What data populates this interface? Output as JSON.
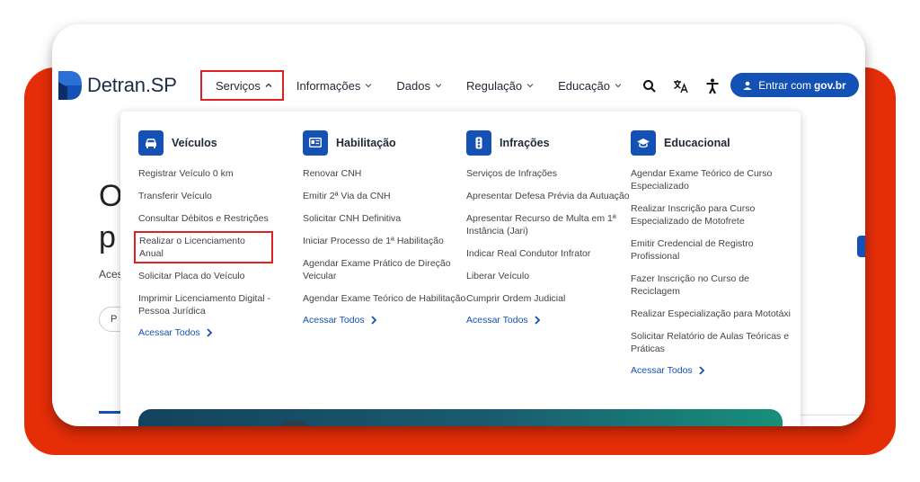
{
  "header": {
    "logo_text": "Detran.SP",
    "nav": [
      {
        "label": "Serviços"
      },
      {
        "label": "Informações"
      },
      {
        "label": "Dados"
      },
      {
        "label": "Regulação"
      },
      {
        "label": "Educação"
      }
    ],
    "login": {
      "label": "Entrar com",
      "bold": "gov.br"
    },
    "icons": [
      "search-icon",
      "translate-icon",
      "accessibility-icon"
    ]
  },
  "background": {
    "title_line1": "O",
    "title_line2": "p",
    "text": "Aces",
    "pill": "P"
  },
  "menu": {
    "columns": [
      {
        "title": "Veículos",
        "icon": "car-icon",
        "links": [
          "Registrar Veículo 0 km",
          "Transferir Veículo",
          "Consultar Débitos e Restrições",
          "Realizar o Licenciamento Anual",
          "Solicitar Placa do Veículo",
          "Imprimir Licenciamento Digital - Pessoa Jurídica"
        ],
        "all": "Acessar Todos"
      },
      {
        "title": "Habilitação",
        "icon": "id-card-icon",
        "links": [
          "Renovar CNH",
          "Emitir 2ª Via da CNH",
          "Solicitar CNH Definitiva",
          "Iniciar Processo de 1ª Habilitação",
          "Agendar Exame Prático de Direção Veicular",
          "Agendar Exame Teórico de Habilitação"
        ],
        "all": "Acessar Todos"
      },
      {
        "title": "Infrações",
        "icon": "traffic-light-icon",
        "links": [
          "Serviços de Infrações",
          "Apresentar Defesa Prévia da Autuação",
          "Apresentar Recurso de Multa em 1ª Instância (Jari)",
          "Indicar Real Condutor Infrator",
          "Liberar Veículo",
          "Cumprir Ordem Judicial"
        ],
        "all": "Acessar Todos"
      },
      {
        "title": "Educacional",
        "icon": "graduation-cap-icon",
        "links": [
          "Agendar Exame Teórico de Curso Especializado",
          "Realizar Inscrição para Curso Especializado de Motofrete",
          "Emitir Credencial de Registro Profissional",
          "Fazer Inscrição no Curso de Reciclagem",
          "Realizar Especialização para Mototáxi",
          "Solicitar Relatório de Aulas Teóricas e Práticas"
        ],
        "all": "Acessar Todos"
      }
    ]
  },
  "colors": {
    "accent": "#1351b4",
    "highlight": "#e02020",
    "backdrop": "#e52d08"
  }
}
